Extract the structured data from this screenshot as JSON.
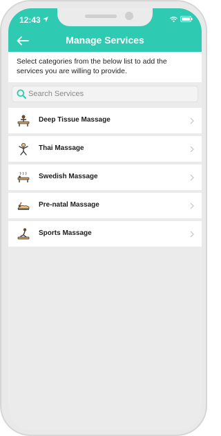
{
  "status_bar": {
    "time": "12:43"
  },
  "header": {
    "title": "Manage Services"
  },
  "intro": {
    "text": "Select categories from the below list to add the services you are willing to provide."
  },
  "search": {
    "placeholder": "Search Services",
    "value": ""
  },
  "services": [
    {
      "label": "Deep Tissue Massage",
      "icon": "deep-tissue-icon"
    },
    {
      "label": "Thai Massage",
      "icon": "thai-massage-icon"
    },
    {
      "label": "Swedish Massage",
      "icon": "swedish-massage-icon"
    },
    {
      "label": "Pre-natal Massage",
      "icon": "prenatal-massage-icon"
    },
    {
      "label": "Sports Massage",
      "icon": "sports-massage-icon"
    }
  ],
  "colors": {
    "accent": "#2ecbb2",
    "background": "#ebebeb"
  }
}
